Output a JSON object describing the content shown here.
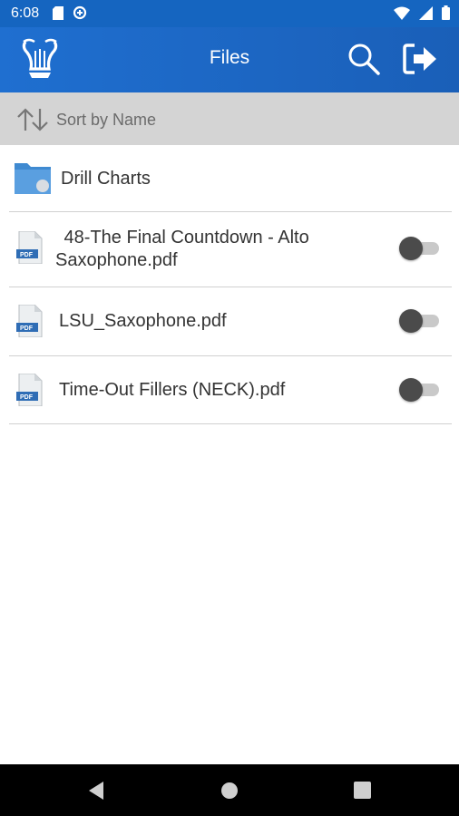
{
  "status_bar": {
    "time": "6:08",
    "icons_left": [
      "sd-card-icon",
      "data-saver-icon"
    ],
    "icons_right": [
      "wifi-icon",
      "signal-icon",
      "battery-icon"
    ]
  },
  "app_bar": {
    "title": "Files",
    "logo_icon": "lyre-icon",
    "actions": [
      "search-icon",
      "logout-icon"
    ],
    "color": "#1a66c4"
  },
  "sort": {
    "label": "Sort by Name",
    "icon": "sort-arrows-icon"
  },
  "folders": [
    {
      "name": "Drill Charts",
      "icon": "folder-icon"
    }
  ],
  "files": [
    {
      "name_line1": " 48-The Final Countdown - Alto",
      "name_line2": "Saxophone.pdf",
      "icon": "pdf-icon",
      "toggle": false
    },
    {
      "name_line1": "LSU_Saxophone.pdf",
      "name_line2": "",
      "icon": "pdf-icon",
      "toggle": false
    },
    {
      "name_line1": "Time-Out Fillers (NECK).pdf",
      "name_line2": "",
      "icon": "pdf-icon",
      "toggle": false
    }
  ],
  "nav_bar": {
    "buttons": [
      "back-icon",
      "home-icon",
      "recents-icon"
    ]
  }
}
